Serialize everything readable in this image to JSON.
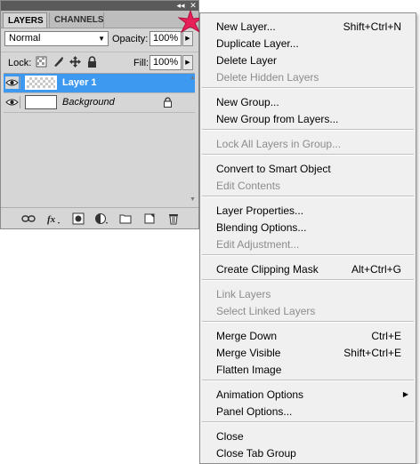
{
  "panel": {
    "tabs": [
      {
        "label": "LAYERS",
        "active": true
      },
      {
        "label": "CHANNELS",
        "active": false
      }
    ],
    "collapse_glyph": "◂◂",
    "close_glyph": "✕",
    "blend_mode": "Normal",
    "opacity_label": "Opacity:",
    "opacity_value": "100%",
    "lock_label": "Lock:",
    "lock_icons": [
      "lock-transparent-pixels-icon",
      "lock-image-pixels-icon",
      "lock-position-icon",
      "lock-all-icon"
    ],
    "fill_label": "Fill:",
    "fill_value": "100%",
    "layers": [
      {
        "name": "Layer 1",
        "selected": true,
        "visible": true,
        "thumbnail": "transparent"
      },
      {
        "name": "Background",
        "selected": false,
        "visible": true,
        "thumbnail": "white",
        "locked": true
      }
    ],
    "footer_icons": [
      "link-layers-icon",
      "fx-layer-style-icon",
      "layer-mask-icon",
      "adjustment-layer-icon",
      "new-group-folder-icon",
      "new-layer-icon",
      "trash-icon"
    ],
    "selection_color": "#3d99f0"
  },
  "menu": {
    "groups": [
      [
        {
          "label": "New Layer...",
          "shortcut": "Shift+Ctrl+N",
          "enabled": true
        },
        {
          "label": "Duplicate Layer...",
          "enabled": true
        },
        {
          "label": "Delete Layer",
          "enabled": true
        },
        {
          "label": "Delete Hidden Layers",
          "enabled": false
        }
      ],
      [
        {
          "label": "New Group...",
          "enabled": true
        },
        {
          "label": "New Group from Layers...",
          "enabled": true
        }
      ],
      [
        {
          "label": "Lock All Layers in Group...",
          "enabled": false
        }
      ],
      [
        {
          "label": "Convert to Smart Object",
          "enabled": true
        },
        {
          "label": "Edit Contents",
          "enabled": false
        }
      ],
      [
        {
          "label": "Layer Properties...",
          "enabled": true
        },
        {
          "label": "Blending Options...",
          "enabled": true
        },
        {
          "label": "Edit Adjustment...",
          "enabled": false
        }
      ],
      [
        {
          "label": "Create Clipping Mask",
          "shortcut": "Alt+Ctrl+G",
          "enabled": true
        }
      ],
      [
        {
          "label": "Link Layers",
          "enabled": false
        },
        {
          "label": "Select Linked Layers",
          "enabled": false
        }
      ],
      [
        {
          "label": "Merge Down",
          "shortcut": "Ctrl+E",
          "enabled": true
        },
        {
          "label": "Merge Visible",
          "shortcut": "Shift+Ctrl+E",
          "enabled": true
        },
        {
          "label": "Flatten Image",
          "enabled": true
        }
      ],
      [
        {
          "label": "Animation Options",
          "enabled": true,
          "submenu": true
        },
        {
          "label": "Panel Options...",
          "enabled": true
        }
      ],
      [
        {
          "label": "Close",
          "enabled": true
        },
        {
          "label": "Close Tab Group",
          "enabled": true
        }
      ]
    ],
    "disabled_color": "#8c8c8c"
  }
}
